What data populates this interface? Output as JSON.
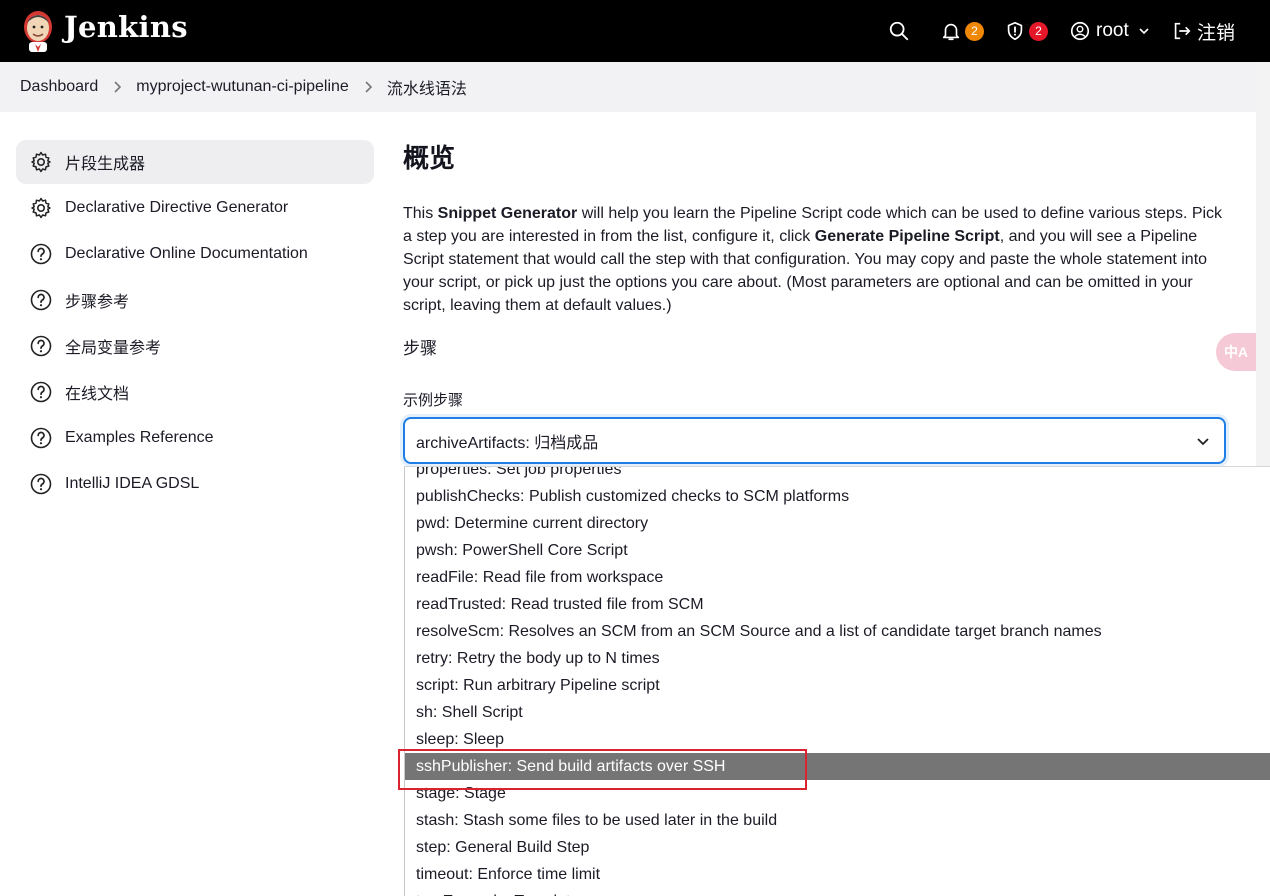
{
  "header": {
    "brand": "Jenkins",
    "notifications_count": "2",
    "security_count": "2",
    "user": "root",
    "logout": "注销"
  },
  "breadcrumb": [
    "Dashboard",
    "myproject-wutunan-ci-pipeline",
    "流水线语法"
  ],
  "sidebar": {
    "items": [
      {
        "label": "片段生成器",
        "icon": "gear-icon",
        "active": true
      },
      {
        "label": "Declarative Directive Generator",
        "icon": "gear-icon"
      },
      {
        "label": "Declarative Online Documentation",
        "icon": "help-icon"
      },
      {
        "label": "步骤参考",
        "icon": "help-icon"
      },
      {
        "label": "全局变量参考",
        "icon": "help-icon"
      },
      {
        "label": "在线文档",
        "icon": "help-icon"
      },
      {
        "label": "Examples Reference",
        "icon": "help-icon"
      },
      {
        "label": "IntelliJ IDEA GDSL",
        "icon": "help-icon"
      }
    ]
  },
  "main": {
    "title": "概览",
    "intro_1": "This ",
    "intro_b1": "Snippet Generator",
    "intro_2": " will help you learn the Pipeline Script code which can be used to define various steps. Pick a step you are interested in from the list, configure it, click ",
    "intro_b2": "Generate Pipeline Script",
    "intro_3": ", and you will see a Pipeline Script statement that would call the step with that configuration. You may copy and paste the whole statement into your script, or pick up just the options you care about. (Most parameters are optional and can be omitted in your script, leaving them at default values.)",
    "steps_label": "步骤",
    "sample_step_label": "示例步骤",
    "selected_value": "archiveArtifacts: 归档成品"
  },
  "dropdown": {
    "options": [
      "properties: Set job properties",
      "publishChecks: Publish customized checks to SCM platforms",
      "pwd: Determine current directory",
      "pwsh: PowerShell Core Script",
      "readFile: Read file from workspace",
      "readTrusted: Read trusted file from SCM",
      "resolveScm: Resolves an SCM from an SCM Source and a list of candidate target branch names",
      "retry: Retry the body up to N times",
      "script: Run arbitrary Pipeline script",
      "sh: Shell Script",
      "sleep: Sleep",
      "sshPublisher: Send build artifacts over SSH",
      "stage: Stage",
      "stash: Stash some files to be used later in the build",
      "step: General Build Step",
      "timeout: Enforce time limit",
      "tm: Expand a Template"
    ],
    "highlighted_index": 11
  },
  "translate_fab": "中A",
  "colors": {
    "accent": "#1f7ee5",
    "highlight": "#757575",
    "annotation": "#d9232e",
    "badge_orange": "#f08705",
    "badge_red": "#e5182a"
  }
}
